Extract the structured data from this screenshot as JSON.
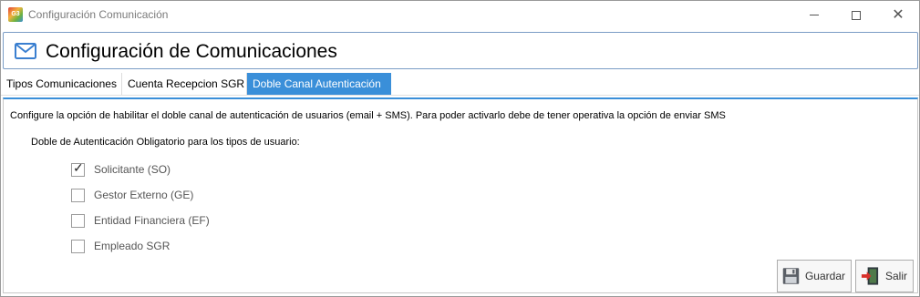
{
  "window": {
    "app_icon_text": "G3",
    "title": "Configuración Comunicación"
  },
  "header": {
    "title": "Configuración de Comunicaciones",
    "icon": "mail-icon"
  },
  "tabs": [
    {
      "label": "Tipos Comunicaciones",
      "active": false
    },
    {
      "label": "Cuenta Recepcion SGR",
      "active": false
    },
    {
      "label": "Doble Canal Autenticación",
      "active": true
    }
  ],
  "content": {
    "description": "Configure la opción de habilitar el doble canal de autenticación de usuarios (email + SMS). Para poder activarlo debe de tener operativa la opción de enviar SMS",
    "group_label": "Doble de Autenticación Obligatorio para los tipos de usuario:",
    "options": [
      {
        "label": "Solicitante (SO)",
        "checked": true
      },
      {
        "label": "Gestor Externo (GE)",
        "checked": false
      },
      {
        "label": "Entidad Financiera (EF)",
        "checked": false
      },
      {
        "label": "Empleado SGR",
        "checked": false
      }
    ]
  },
  "buttons": {
    "save_label": "Guardar",
    "exit_label": "Salir"
  },
  "colors": {
    "accent": "#3a8fd9",
    "header_border": "#7a9cc5"
  }
}
